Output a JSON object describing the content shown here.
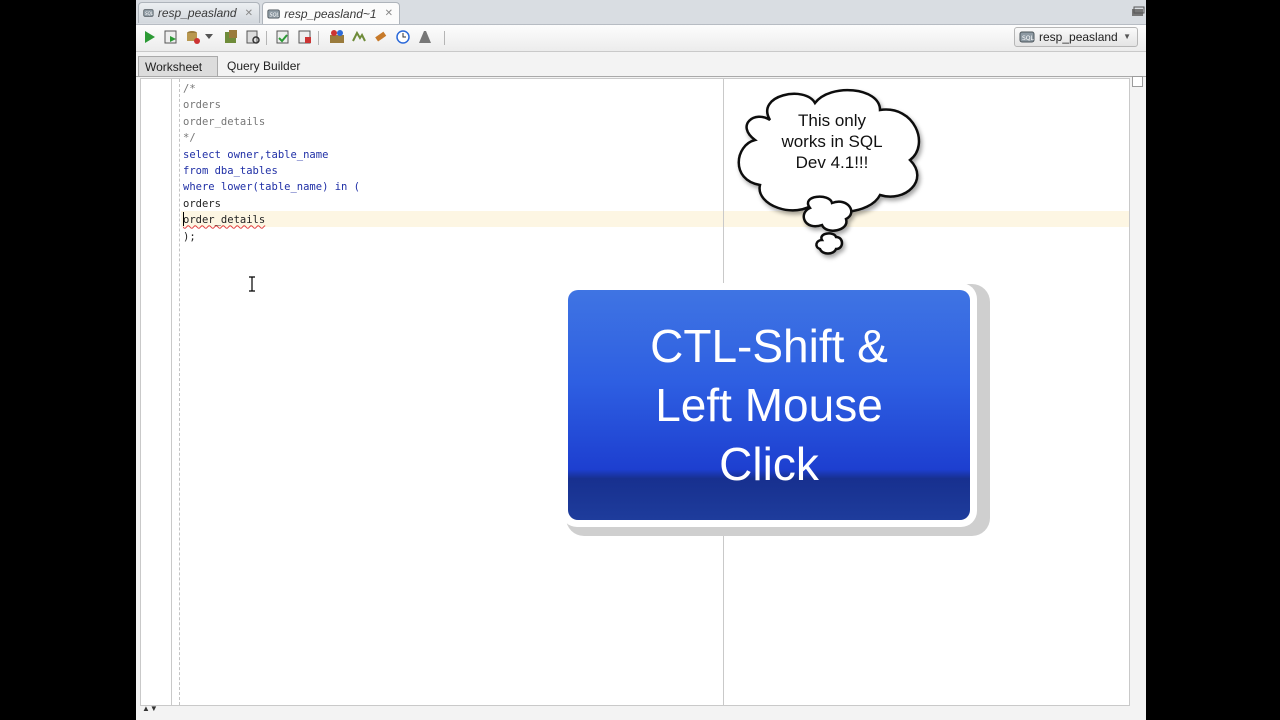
{
  "document_tabs": [
    {
      "label": "resp_peasland",
      "active": false
    },
    {
      "label": "resp_peasland~1",
      "active": true
    }
  ],
  "toolbar": {
    "buttons": [
      "run-statement-icon",
      "run-script-icon",
      "commit-icon",
      "rollback-icon",
      "autotrace-icon",
      "explain-plan-icon",
      "sql-tuning-icon",
      "unshared-sql-icon",
      "clear-icon",
      "history-icon",
      "format-icon"
    ],
    "connection": {
      "label": "resp_peasland"
    }
  },
  "sub_tabs": [
    {
      "label": "Worksheet",
      "active": true
    },
    {
      "label": "Query Builder",
      "active": false
    }
  ],
  "editor": {
    "lines": [
      "/*",
      "orders",
      "order_details",
      "*/",
      "",
      "select owner,table_name",
      "from dba_tables",
      "where lower(table_name) in (",
      "orders",
      "order_details",
      ");"
    ]
  },
  "overlay": {
    "bubble_lines": [
      "This only",
      "works in SQL",
      "Dev 4.1!!!"
    ],
    "callout_lines": [
      "CTL-Shift &",
      "Left Mouse",
      "Click"
    ]
  },
  "colors": {
    "keyword": "#1f2fa6",
    "comment": "#767676",
    "callout_blue": "#2e5fe2",
    "current_line": "#fdf6e3"
  }
}
